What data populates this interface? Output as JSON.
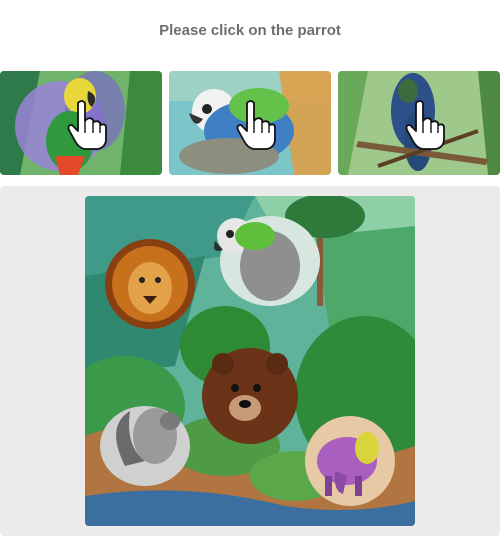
{
  "prompt": {
    "text": "Please click on the parrot"
  },
  "examples": [
    {
      "name": "example-image-parrot-1",
      "icon": "hand-pointer-icon"
    },
    {
      "name": "example-image-parrot-2",
      "icon": "hand-pointer-icon"
    },
    {
      "name": "example-image-parrot-3",
      "icon": "hand-pointer-icon"
    }
  ],
  "challenge": {
    "animals": [
      "lion",
      "parrot",
      "bear",
      "squirrel",
      "elephant"
    ]
  },
  "colors": {
    "prompt_text": "#6e6e6e",
    "panel_bg": "#ebebeb"
  }
}
